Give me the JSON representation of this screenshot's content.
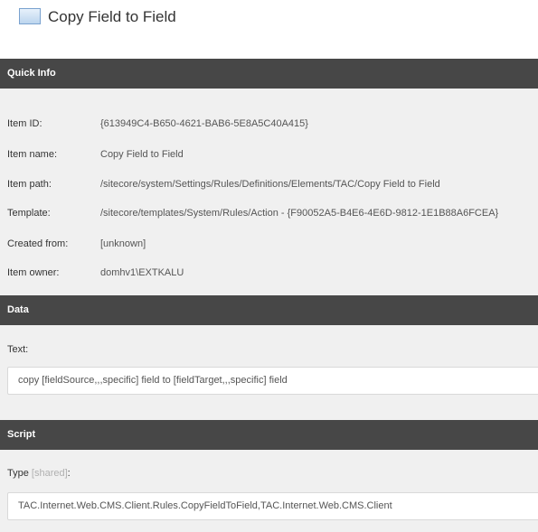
{
  "item": {
    "title": "Copy Field to Field",
    "icon": "item-document-icon"
  },
  "quick_info": {
    "header": "Quick Info",
    "rows": [
      {
        "label": "Item ID:",
        "value": "{613949C4-B650-4621-BAB6-5E8A5C40A415}"
      },
      {
        "label": "Item name:",
        "value": "Copy Field to Field"
      },
      {
        "label": "Item path:",
        "value": "/sitecore/system/Settings/Rules/Definitions/Elements/TAC/Copy Field to Field"
      },
      {
        "label": "Template:",
        "value": "/sitecore/templates/System/Rules/Action - {F90052A5-B4E6-4E6D-9812-1E1B88A6FCEA}"
      },
      {
        "label": "Created from:",
        "value": "[unknown]"
      },
      {
        "label": "Item owner:",
        "value": "domhv1\\EXTKALU"
      }
    ]
  },
  "data_section": {
    "header": "Data",
    "text_label": "Text:",
    "text_value": "copy [fieldSource,,,specific] field to [fieldTarget,,,specific] field"
  },
  "script_section": {
    "header": "Script",
    "type_label": "Type",
    "type_shared": "[shared]",
    "type_suffix": ":",
    "type_value": "TAC.Internet.Web.CMS.Client.Rules.CopyFieldToField,TAC.Internet.Web.CMS.Client"
  },
  "colors": {
    "header_bg": "#474747",
    "panel_bg": "#f0f0f0",
    "shared_tag": "#b0b0b0"
  }
}
